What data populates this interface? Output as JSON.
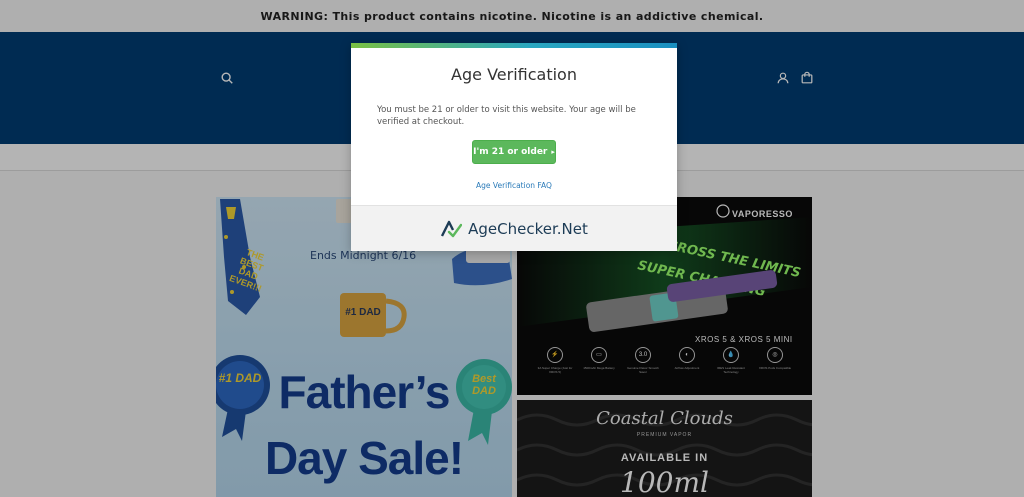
{
  "announcement": {
    "text": "WARNING: This product contains nicotine. Nicotine is an addictive chemical."
  },
  "header": {
    "search_icon": "search-icon",
    "account_icon": "user-icon",
    "cart_icon": "cart-icon",
    "background_color": "#003c72"
  },
  "banners": {
    "fathers_day": {
      "ends_text": "Ends Midnight 6/16",
      "title_line1": "Father’s",
      "title_line2": "Day Sale!",
      "badge1": "#1 DAD",
      "badge2": "Best DAD",
      "mug": "#1 DAD"
    },
    "vaporesso": {
      "brand": "VAPORESSO",
      "model": "XROS 5 & XROS 5 MINI",
      "features": [
        "3A Super Charge (Just for XROS 5)",
        "1500mAh Mega Battery",
        "Genuine Flavor Smooth Savor",
        "Airflow Adjustment",
        "IRES Leak Resistant Technology",
        "XROS Pods Compatible"
      ],
      "feature_icons": [
        "⚡",
        "▭",
        "3.0",
        "◐",
        "💧",
        "◎"
      ]
    },
    "coastal_clouds": {
      "brand": "Coastal Clouds",
      "sub": "PREMIUM VAPOR",
      "available": "AVAILABLE IN",
      "size": "100ml"
    }
  },
  "modal": {
    "title": "Age Verification",
    "message": "You must be 21 or older to visit this website. Your age will be verified at checkout.",
    "confirm_button": "I'm 21 or older",
    "confirm_arrow": "▸",
    "faq_link": "Age Verification FAQ",
    "footer_brand": "AgeChecker.Net",
    "accent_green": "#5cb85c",
    "accent_blue": "#2b7bb9"
  }
}
